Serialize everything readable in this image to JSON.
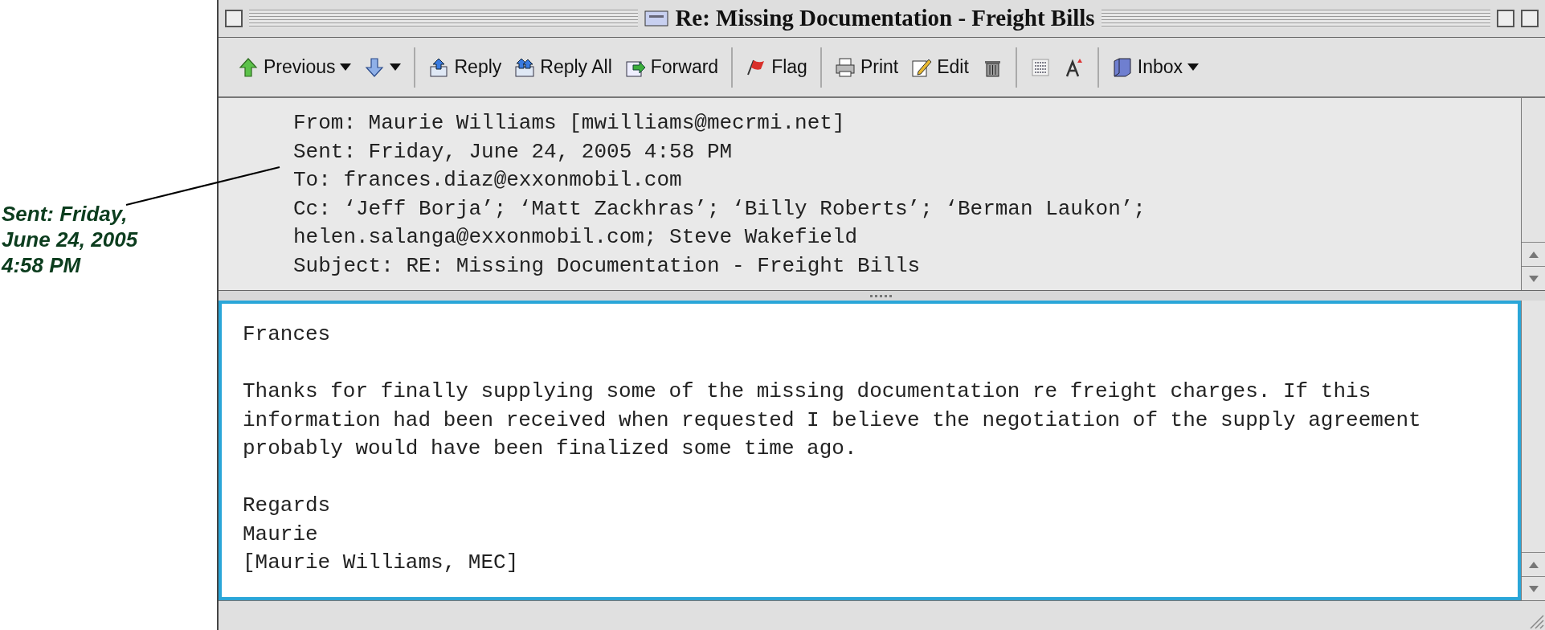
{
  "annotation": {
    "lines": [
      "Sent: Friday,",
      "June 24, 2005",
      "4:58 PM"
    ]
  },
  "window": {
    "title": "Re: Missing Documentation - Freight Bills"
  },
  "toolbar": {
    "groups": [
      [
        {
          "label": "Previous",
          "dropdown": true
        },
        {
          "dropdown": true
        }
      ],
      [
        {
          "label": "Reply",
          "dropdown": false
        },
        {
          "label": "Reply All",
          "dropdown": false
        },
        {
          "label": "Forward",
          "dropdown": false
        }
      ],
      [
        {
          "label": "Flag",
          "dropdown": false
        }
      ],
      [
        {
          "label": "Print",
          "dropdown": false
        },
        {
          "label": "Edit",
          "dropdown": false
        },
        {
          "dropdown": false
        }
      ],
      [
        {
          "dropdown": false
        },
        {
          "dropdown": false
        }
      ],
      [
        {
          "label": "Inbox",
          "dropdown": true
        }
      ]
    ]
  },
  "header": {
    "lines": [
      "From: Maurie Williams [mwilliams@mecrmi.net]",
      "Sent: Friday, June 24, 2005 4:58 PM",
      "To: frances.diaz@exxonmobil.com",
      "Cc: ‘Jeff Borja’; ‘Matt Zackhras’; ‘Billy Roberts’; ‘Berman Laukon’;",
      "helen.salanga@exxonmobil.com; Steve Wakefield",
      "Subject: RE: Missing Documentation - Freight Bills"
    ]
  },
  "body": {
    "paragraphs": [
      [
        "Frances"
      ],
      [
        "Thanks for finally supplying some of the missing documentation re freight charges. If this",
        "information had been received when requested I believe the negotiation of the supply agreement",
        "probably would have been finalized some time ago."
      ],
      [
        "Regards",
        "Maurie",
        "[Maurie Williams, MEC]"
      ]
    ]
  }
}
